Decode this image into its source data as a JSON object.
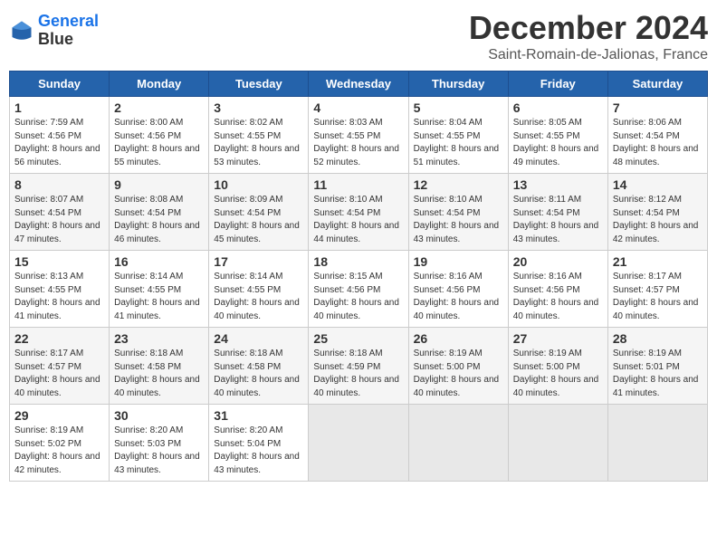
{
  "header": {
    "title": "December 2024",
    "subtitle": "Saint-Romain-de-Jalionas, France",
    "logo_line1": "General",
    "logo_line2": "Blue"
  },
  "weekdays": [
    "Sunday",
    "Monday",
    "Tuesday",
    "Wednesday",
    "Thursday",
    "Friday",
    "Saturday"
  ],
  "weeks": [
    [
      {
        "day": 1,
        "rise": "7:59 AM",
        "set": "4:56 PM",
        "daylight": "8 hours and 56 minutes"
      },
      {
        "day": 2,
        "rise": "8:00 AM",
        "set": "4:56 PM",
        "daylight": "8 hours and 55 minutes"
      },
      {
        "day": 3,
        "rise": "8:02 AM",
        "set": "4:55 PM",
        "daylight": "8 hours and 53 minutes"
      },
      {
        "day": 4,
        "rise": "8:03 AM",
        "set": "4:55 PM",
        "daylight": "8 hours and 52 minutes"
      },
      {
        "day": 5,
        "rise": "8:04 AM",
        "set": "4:55 PM",
        "daylight": "8 hours and 51 minutes"
      },
      {
        "day": 6,
        "rise": "8:05 AM",
        "set": "4:55 PM",
        "daylight": "8 hours and 49 minutes"
      },
      {
        "day": 7,
        "rise": "8:06 AM",
        "set": "4:54 PM",
        "daylight": "8 hours and 48 minutes"
      }
    ],
    [
      {
        "day": 8,
        "rise": "8:07 AM",
        "set": "4:54 PM",
        "daylight": "8 hours and 47 minutes"
      },
      {
        "day": 9,
        "rise": "8:08 AM",
        "set": "4:54 PM",
        "daylight": "8 hours and 46 minutes"
      },
      {
        "day": 10,
        "rise": "8:09 AM",
        "set": "4:54 PM",
        "daylight": "8 hours and 45 minutes"
      },
      {
        "day": 11,
        "rise": "8:10 AM",
        "set": "4:54 PM",
        "daylight": "8 hours and 44 minutes"
      },
      {
        "day": 12,
        "rise": "8:10 AM",
        "set": "4:54 PM",
        "daylight": "8 hours and 43 minutes"
      },
      {
        "day": 13,
        "rise": "8:11 AM",
        "set": "4:54 PM",
        "daylight": "8 hours and 43 minutes"
      },
      {
        "day": 14,
        "rise": "8:12 AM",
        "set": "4:54 PM",
        "daylight": "8 hours and 42 minutes"
      }
    ],
    [
      {
        "day": 15,
        "rise": "8:13 AM",
        "set": "4:55 PM",
        "daylight": "8 hours and 41 minutes"
      },
      {
        "day": 16,
        "rise": "8:14 AM",
        "set": "4:55 PM",
        "daylight": "8 hours and 41 minutes"
      },
      {
        "day": 17,
        "rise": "8:14 AM",
        "set": "4:55 PM",
        "daylight": "8 hours and 40 minutes"
      },
      {
        "day": 18,
        "rise": "8:15 AM",
        "set": "4:56 PM",
        "daylight": "8 hours and 40 minutes"
      },
      {
        "day": 19,
        "rise": "8:16 AM",
        "set": "4:56 PM",
        "daylight": "8 hours and 40 minutes"
      },
      {
        "day": 20,
        "rise": "8:16 AM",
        "set": "4:56 PM",
        "daylight": "8 hours and 40 minutes"
      },
      {
        "day": 21,
        "rise": "8:17 AM",
        "set": "4:57 PM",
        "daylight": "8 hours and 40 minutes"
      }
    ],
    [
      {
        "day": 22,
        "rise": "8:17 AM",
        "set": "4:57 PM",
        "daylight": "8 hours and 40 minutes"
      },
      {
        "day": 23,
        "rise": "8:18 AM",
        "set": "4:58 PM",
        "daylight": "8 hours and 40 minutes"
      },
      {
        "day": 24,
        "rise": "8:18 AM",
        "set": "4:58 PM",
        "daylight": "8 hours and 40 minutes"
      },
      {
        "day": 25,
        "rise": "8:18 AM",
        "set": "4:59 PM",
        "daylight": "8 hours and 40 minutes"
      },
      {
        "day": 26,
        "rise": "8:19 AM",
        "set": "5:00 PM",
        "daylight": "8 hours and 40 minutes"
      },
      {
        "day": 27,
        "rise": "8:19 AM",
        "set": "5:00 PM",
        "daylight": "8 hours and 40 minutes"
      },
      {
        "day": 28,
        "rise": "8:19 AM",
        "set": "5:01 PM",
        "daylight": "8 hours and 41 minutes"
      }
    ],
    [
      {
        "day": 29,
        "rise": "8:19 AM",
        "set": "5:02 PM",
        "daylight": "8 hours and 42 minutes"
      },
      {
        "day": 30,
        "rise": "8:20 AM",
        "set": "5:03 PM",
        "daylight": "8 hours and 43 minutes"
      },
      {
        "day": 31,
        "rise": "8:20 AM",
        "set": "5:04 PM",
        "daylight": "8 hours and 43 minutes"
      },
      null,
      null,
      null,
      null
    ]
  ]
}
